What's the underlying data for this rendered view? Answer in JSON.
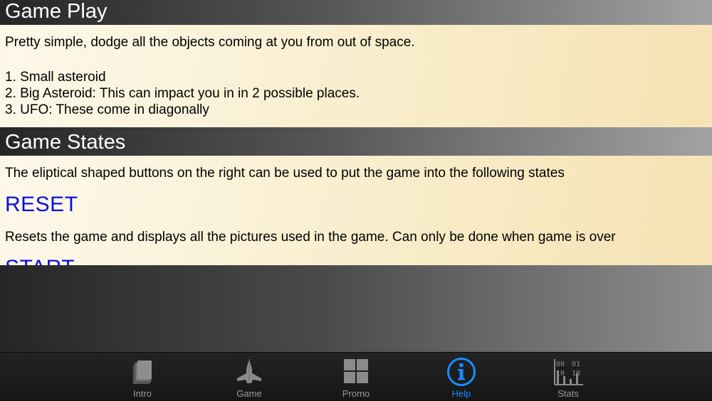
{
  "sections": [
    {
      "title": "Game Play",
      "intro": "Pretty simple, dodge all the objects coming at you from out of space.",
      "items": [
        "1. Small asteroid",
        "2. Big Asteroid: This can impact you in in 2 possible places.",
        "3. UFO: These come in diagonally"
      ]
    },
    {
      "title": "Game States",
      "intro": "The eliptical shaped buttons on the right can be used to put the game into the following  states",
      "states": [
        {
          "name": "RESET",
          "description": "Resets the game and displays all the pictures used in the game. Can only be done when game is over"
        },
        {
          "name": "START"
        }
      ]
    }
  ],
  "tab_bar": {
    "accent_color": "#1a8cff",
    "inactive_color": "#9a9a9a",
    "tabs": [
      {
        "label": "Intro",
        "icon": "book-icon",
        "selected": false
      },
      {
        "label": "Game",
        "icon": "spaceship-icon",
        "selected": false
      },
      {
        "label": "Promo",
        "icon": "grid-icon",
        "selected": false
      },
      {
        "label": "Help",
        "icon": "info-icon",
        "selected": true
      },
      {
        "label": "Stats",
        "icon": "stats-icon",
        "selected": false
      },
      {
        "label": "",
        "icon": "",
        "selected": false
      }
    ],
    "stats_icon_digits": [
      "00",
      "01",
      "10",
      "10"
    ]
  },
  "colors": {
    "heading_blue": "#0a10e0",
    "body_background": "#f8ecc8"
  }
}
